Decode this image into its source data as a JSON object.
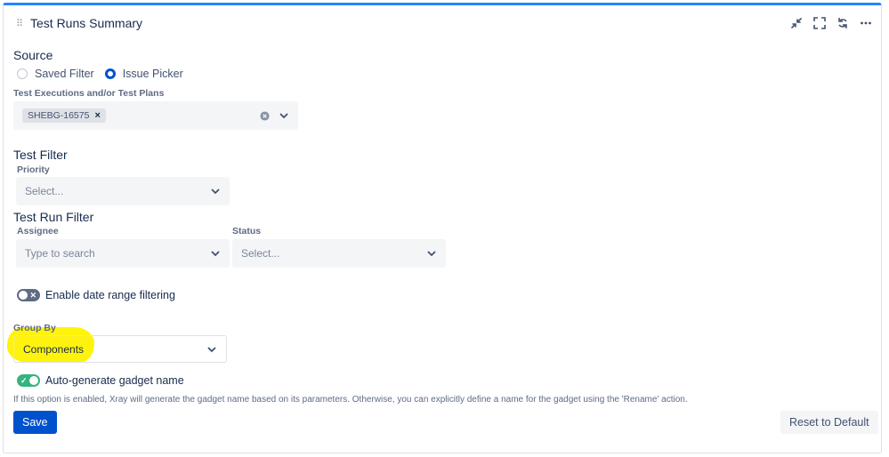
{
  "gadget": {
    "title": "Test Runs Summary",
    "icons": [
      "collapse-icon",
      "fullscreen-icon",
      "refresh-icon",
      "more-icon"
    ]
  },
  "source": {
    "title": "Source",
    "options": [
      "Saved Filter",
      "Issue Picker"
    ],
    "selected": "Issue Picker",
    "picker_label": "Test Executions and/or Test Plans",
    "picker_tags": [
      "SHEBG-16575"
    ]
  },
  "test_filter": {
    "title": "Test Filter",
    "priority_label": "Priority",
    "priority_placeholder": "Select..."
  },
  "test_run_filter": {
    "title": "Test Run Filter",
    "assignee_label": "Assignee",
    "assignee_placeholder": "Type to search",
    "status_label": "Status",
    "status_placeholder": "Select..."
  },
  "date_range": {
    "label": "Enable date range filtering",
    "enabled": false
  },
  "group_by": {
    "label": "Group By",
    "value": "Components"
  },
  "auto_name": {
    "label": "Auto-generate gadget name",
    "enabled": true,
    "help": "If this option is enabled, Xray will generate the gadget name based on its parameters. Otherwise, you can explicitly define a name for the gadget using the 'Rename' action."
  },
  "actions": {
    "save_label": "Save",
    "reset_label": "Reset to Default"
  },
  "colors": {
    "accent": "#0052cc",
    "top_border": "#2684ff",
    "toggle_on": "#36b37e",
    "highlight": "#fff200"
  }
}
